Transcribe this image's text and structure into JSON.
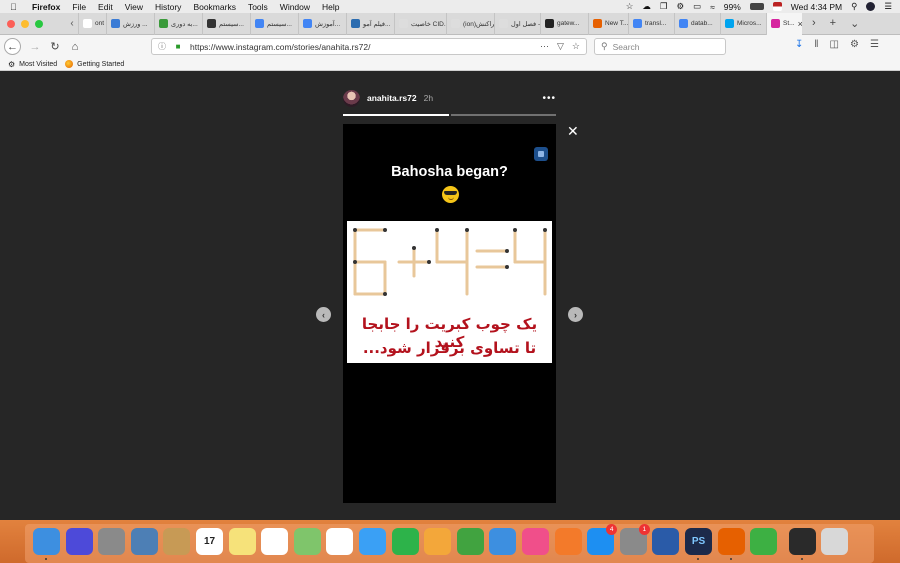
{
  "menubar": {
    "app": "Firefox",
    "items": [
      "File",
      "Edit",
      "View",
      "History",
      "Bookmarks",
      "Tools",
      "Window",
      "Help"
    ],
    "battery": "99%",
    "clock": "Wed 4:34 PM"
  },
  "tabs": [
    {
      "label": "ont",
      "color": "#ffffff"
    },
    {
      "label": "ورزش ...",
      "color": "#3a7bd5"
    },
    {
      "label": "به دوری...",
      "color": "#3a9a3a"
    },
    {
      "label": "سیستم...",
      "color": "#333333"
    },
    {
      "label": "سیستم...",
      "color": "#4285f4"
    },
    {
      "label": "آموزش...",
      "color": "#4285f4"
    },
    {
      "label": "فیلم آمو...",
      "color": "#2b6cb0"
    },
    {
      "label": "خاصیت CID...",
      "color": "#dddddd"
    },
    {
      "label": "(ion)تراکنش...",
      "color": "#dddddd"
    },
    {
      "label": "فصل اول - ff",
      "color": "#dddddd"
    },
    {
      "label": "gatew...",
      "color": "#222222"
    },
    {
      "label": "New T...",
      "color": "#e66000"
    },
    {
      "label": "transl...",
      "color": "#4285f4"
    },
    {
      "label": "datab...",
      "color": "#4285f4"
    },
    {
      "label": "Micros...",
      "color": "#00a4ef"
    },
    {
      "label": "St...",
      "color": "#d6249f",
      "active": true
    }
  ],
  "navbar": {
    "url": "https://www.instagram.com/stories/anahita.rs72/",
    "search_placeholder": "Search"
  },
  "bookmarks": {
    "most_visited": "Most Visited",
    "getting_started": "Getting Started"
  },
  "story": {
    "username": "anahita.rs72",
    "time": "2h",
    "headline": "Bahosha began?",
    "emoji": "smiling-face-with-sunglasses",
    "equation": "6+4=4",
    "caption_line1": "یک چوب کبریت را جابجا کنید",
    "caption_line2": "تا تساوی برقرار شود...",
    "progress_segments": 2,
    "progress_current": 1
  },
  "dock": [
    {
      "name": "finder",
      "color": "#3d8fe0"
    },
    {
      "name": "siri",
      "color": "#4d4ad9"
    },
    {
      "name": "launchpad",
      "color": "#8a8a8a"
    },
    {
      "name": "image-capture",
      "color": "#4d7fb5"
    },
    {
      "name": "contacts",
      "color": "#c79a55"
    },
    {
      "name": "calendar",
      "color": "#ffffff",
      "text": "17"
    },
    {
      "name": "notes",
      "color": "#f6e27a"
    },
    {
      "name": "reminders",
      "color": "#ffffff"
    },
    {
      "name": "maps",
      "color": "#7fc56b"
    },
    {
      "name": "photos",
      "color": "#ffffff"
    },
    {
      "name": "messages",
      "color": "#3aa0f5"
    },
    {
      "name": "facetime",
      "color": "#2db34a"
    },
    {
      "name": "pages",
      "color": "#f3a73a"
    },
    {
      "name": "numbers",
      "color": "#41a340"
    },
    {
      "name": "keynote",
      "color": "#3d8fe0"
    },
    {
      "name": "itunes",
      "color": "#f04f8a"
    },
    {
      "name": "ibooks",
      "color": "#f37a2a"
    },
    {
      "name": "app-store",
      "color": "#1d8ff2",
      "badge": "4"
    },
    {
      "name": "system-preferences",
      "color": "#8a8a8a",
      "badge": "1"
    },
    {
      "name": "quicktime",
      "color": "#2a5ba8"
    },
    {
      "name": "photoshop",
      "color": "#1c2a4a",
      "text": "PS"
    },
    {
      "name": "firefox",
      "color": "#e66000"
    },
    {
      "name": "anaconda",
      "color": "#3db043"
    },
    {
      "name": "terminal",
      "color": "#2a2a2a"
    },
    {
      "name": "trash",
      "color": "#d8d8d8"
    }
  ]
}
